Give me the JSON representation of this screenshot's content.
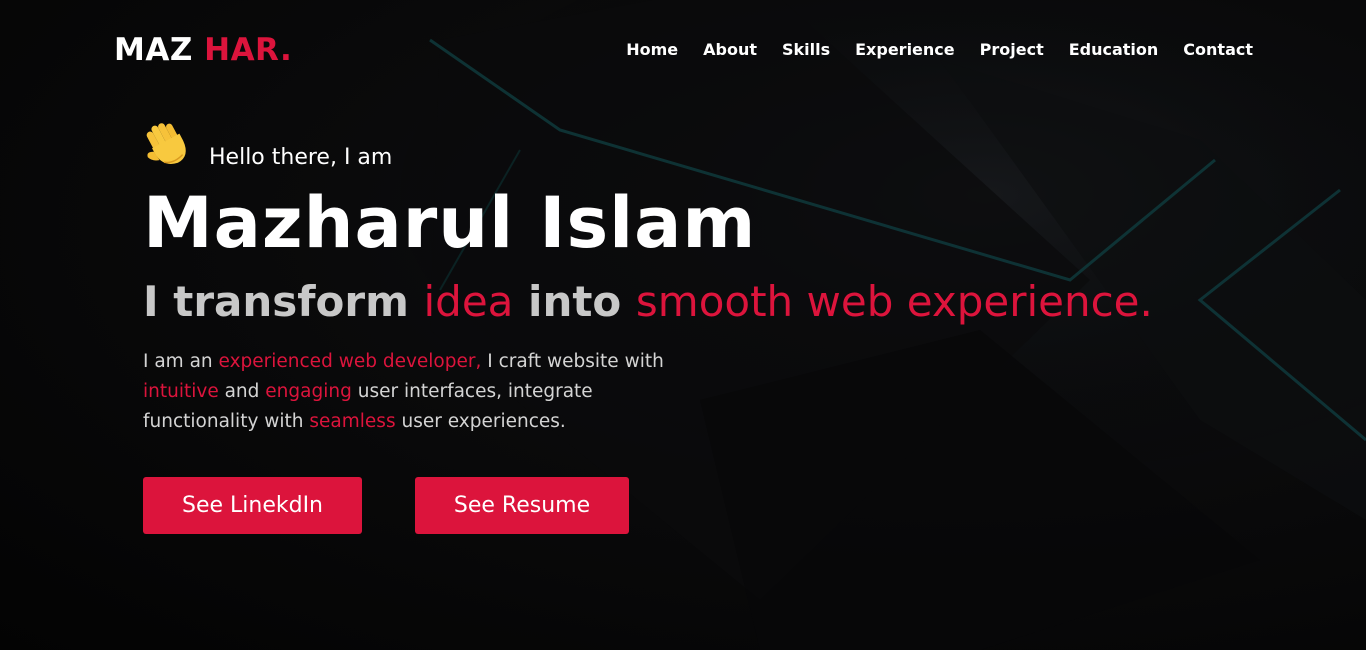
{
  "logo": {
    "first": "MAZ",
    "second": "HAR."
  },
  "nav": {
    "items": [
      "Home",
      "About",
      "Skills",
      "Experience",
      "Project",
      "Education",
      "Contact"
    ]
  },
  "hero": {
    "wave_icon": "waving-hand-icon",
    "greeting": "Hello there, I am",
    "name": "Mazharul Islam",
    "tagline": {
      "part1": "I transform ",
      "part2": "idea",
      "part3": " into ",
      "part4": "smooth web experience."
    },
    "description": {
      "t1": "I am an ",
      "h1": "experienced web developer,",
      "t2": " I craft website with ",
      "h2": "intuitive",
      "t3": " and ",
      "h3": "engaging",
      "t4": " user interfaces, integrate functionality with ",
      "h4": "seamless",
      "t5": " user experiences."
    },
    "buttons": {
      "linkedin": "See LinekdIn",
      "resume": "See Resume"
    }
  },
  "colors": {
    "accent": "#dc143c",
    "background": "#050505",
    "decor_line": "#0f3a3c"
  }
}
